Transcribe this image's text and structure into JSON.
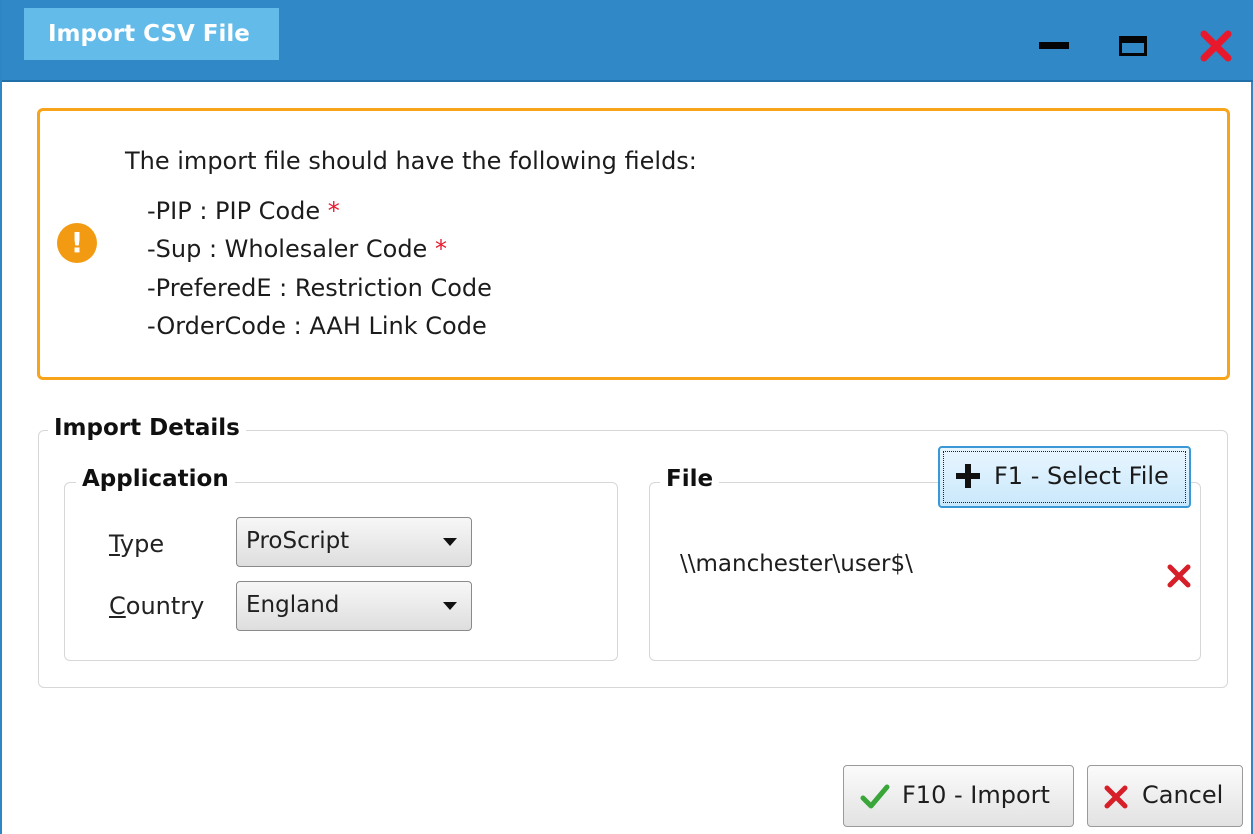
{
  "window": {
    "title": "Import CSV File",
    "colors": {
      "titlebar": "#3088c7",
      "title_tab": "#62bbe9",
      "close": "#e8192c",
      "warning": "#f7a41a"
    }
  },
  "info": {
    "heading": "The import file should have the following fields:",
    "fields": [
      {
        "text": "-PIP : PIP Code",
        "required_mark": "*"
      },
      {
        "text": "-Sup : Wholesaler Code",
        "required_mark": "*"
      },
      {
        "text": "-PreferedE : Restriction Code"
      },
      {
        "text": "-OrderCode : AAH Link Code"
      }
    ],
    "icon": "exclamation-icon"
  },
  "import_details": {
    "legend": "Import Details",
    "application": {
      "legend": "Application",
      "type_label": {
        "mnemonic": "T",
        "rest": "ype"
      },
      "type_value": "ProScript",
      "country_label": {
        "mnemonic": "C",
        "rest": "ountry"
      },
      "country_value": "England"
    },
    "file": {
      "legend": "File",
      "select_button": "F1 - Select File",
      "path": "\\\\manchester\\user$\\"
    }
  },
  "actions": {
    "import_label": "F10 - Import",
    "cancel_label": "Cancel"
  }
}
